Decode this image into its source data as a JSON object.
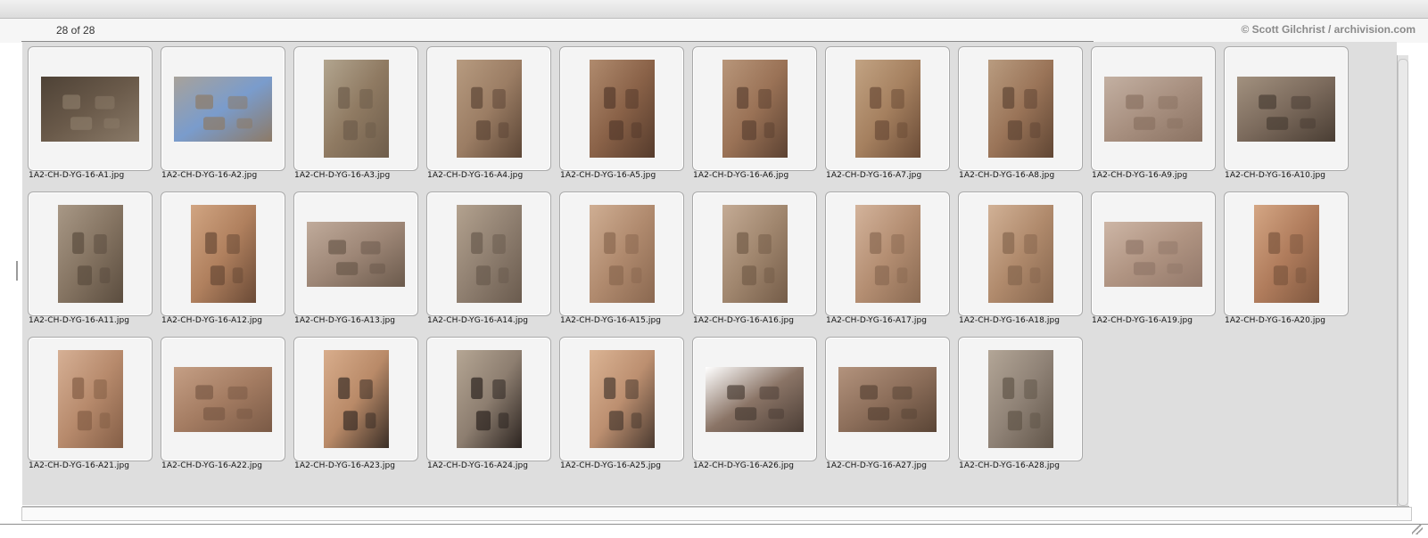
{
  "browser": {
    "count": "28 of 28",
    "credit": "© Scott Gilchrist / archivision.com"
  },
  "thumbnails": [
    {
      "filename": "1A2-CH-D-YG-16-A1.jpg",
      "orientation": "landscape",
      "tone": [
        "#6a5a4a",
        "#8a7a68",
        "#4e4236"
      ]
    },
    {
      "filename": "1A2-CH-D-YG-16-A2.jpg",
      "orientation": "landscape",
      "tone": [
        "#7a9ccc",
        "#8d7a66",
        "#a8a29a"
      ]
    },
    {
      "filename": "1A2-CH-D-YG-16-A3.jpg",
      "orientation": "portrait",
      "tone": [
        "#8f7a62",
        "#6e5d4b",
        "#b2a58f"
      ]
    },
    {
      "filename": "1A2-CH-D-YG-16-A4.jpg",
      "orientation": "portrait",
      "tone": [
        "#9b7d64",
        "#5c4636",
        "#b79b80"
      ]
    },
    {
      "filename": "1A2-CH-D-YG-16-A5.jpg",
      "orientation": "portrait",
      "tone": [
        "#8a6248",
        "#553b2c",
        "#b08b6e"
      ]
    },
    {
      "filename": "1A2-CH-D-YG-16-A6.jpg",
      "orientation": "portrait",
      "tone": [
        "#9a7256",
        "#5c4232",
        "#b8967a"
      ]
    },
    {
      "filename": "1A2-CH-D-YG-16-A7.jpg",
      "orientation": "portrait",
      "tone": [
        "#a5805f",
        "#6b4c37",
        "#c2a383"
      ]
    },
    {
      "filename": "1A2-CH-D-YG-16-A8.jpg",
      "orientation": "portrait",
      "tone": [
        "#9a7458",
        "#604634",
        "#b99c80"
      ]
    },
    {
      "filename": "1A2-CH-D-YG-16-A9.jpg",
      "orientation": "landscape",
      "tone": [
        "#a89080",
        "#8a7262",
        "#c3b0a2"
      ]
    },
    {
      "filename": "1A2-CH-D-YG-16-A10.jpg",
      "orientation": "landscape",
      "tone": [
        "#7b6a5c",
        "#4a3e34",
        "#a2917f"
      ]
    },
    {
      "filename": "1A2-CH-D-YG-16-A11.jpg",
      "orientation": "portrait",
      "tone": [
        "#857462",
        "#5b4d3f",
        "#a89886"
      ]
    },
    {
      "filename": "1A2-CH-D-YG-16-A12.jpg",
      "orientation": "portrait",
      "tone": [
        "#b0805e",
        "#6a4a36",
        "#d1a582"
      ]
    },
    {
      "filename": "1A2-CH-D-YG-16-A13.jpg",
      "orientation": "landscape",
      "tone": [
        "#9d8676",
        "#6b5a4c",
        "#c0ab9b"
      ]
    },
    {
      "filename": "1A2-CH-D-YG-16-A14.jpg",
      "orientation": "portrait",
      "tone": [
        "#8f7f70",
        "#6a5b4e",
        "#b3a28f"
      ]
    },
    {
      "filename": "1A2-CH-D-YG-16-A15.jpg",
      "orientation": "portrait",
      "tone": [
        "#b08a6e",
        "#8a6850",
        "#cfae93"
      ]
    },
    {
      "filename": "1A2-CH-D-YG-16-A16.jpg",
      "orientation": "portrait",
      "tone": [
        "#a0866e",
        "#745c48",
        "#c4ab95"
      ]
    },
    {
      "filename": "1A2-CH-D-YG-16-A17.jpg",
      "orientation": "portrait",
      "tone": [
        "#b48e72",
        "#8a6a52",
        "#d3b39b"
      ]
    },
    {
      "filename": "1A2-CH-D-YG-16-A18.jpg",
      "orientation": "portrait",
      "tone": [
        "#b08a6c",
        "#86664e",
        "#d1b196"
      ]
    },
    {
      "filename": "1A2-CH-D-YG-16-A19.jpg",
      "orientation": "landscape",
      "tone": [
        "#b09482",
        "#92786a",
        "#cdb6a6"
      ]
    },
    {
      "filename": "1A2-CH-D-YG-16-A20.jpg",
      "orientation": "portrait",
      "tone": [
        "#b07c5c",
        "#7e573f",
        "#d4a684"
      ]
    },
    {
      "filename": "1A2-CH-D-YG-16-A21.jpg",
      "orientation": "portrait",
      "tone": [
        "#b78a6c",
        "#845e46",
        "#d6b095"
      ]
    },
    {
      "filename": "1A2-CH-D-YG-16-A22.jpg",
      "orientation": "landscape",
      "tone": [
        "#a47c62",
        "#7a5a46",
        "#c59f85"
      ]
    },
    {
      "filename": "1A2-CH-D-YG-16-A23.jpg",
      "orientation": "portrait",
      "tone": [
        "#b98a68",
        "#3a2e26",
        "#d8ad8c"
      ]
    },
    {
      "filename": "1A2-CH-D-YG-16-A24.jpg",
      "orientation": "portrait",
      "tone": [
        "#8d7e70",
        "#2c2420",
        "#b5a694"
      ]
    },
    {
      "filename": "1A2-CH-D-YG-16-A25.jpg",
      "orientation": "portrait",
      "tone": [
        "#bc8f70",
        "#4a3a30",
        "#dbb494"
      ]
    },
    {
      "filename": "1A2-CH-D-YG-16-A26.jpg",
      "orientation": "landscape",
      "tone": [
        "#8a7466",
        "#4c3e36",
        "#ffffff"
      ]
    },
    {
      "filename": "1A2-CH-D-YG-16-A27.jpg",
      "orientation": "landscape",
      "tone": [
        "#8c6e5a",
        "#5a4536",
        "#b3937d"
      ]
    },
    {
      "filename": "1A2-CH-D-YG-16-A28.jpg",
      "orientation": "portrait",
      "tone": [
        "#8f8276",
        "#615549",
        "#b3a697"
      ]
    }
  ]
}
